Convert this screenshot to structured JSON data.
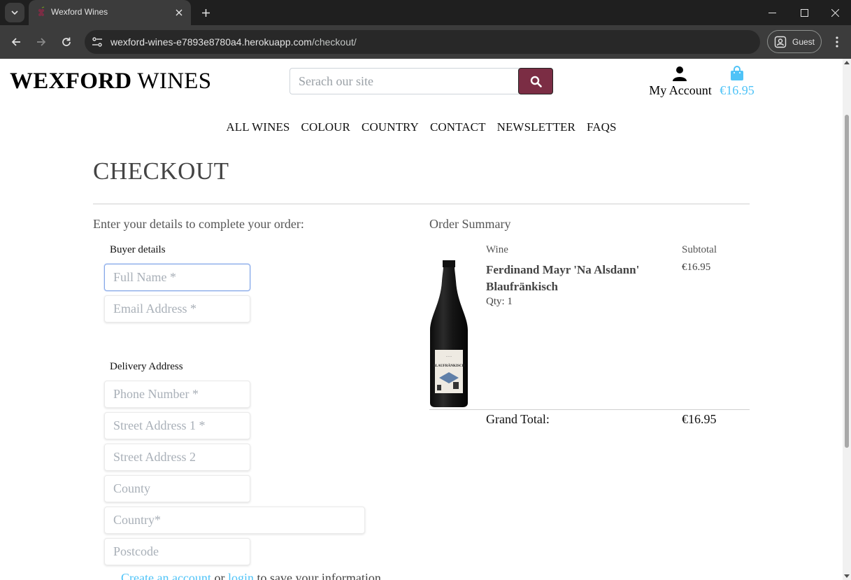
{
  "browser": {
    "tab_title": "Wexford Wines",
    "url_host": "wexford-wines-e7893e8780a4.herokuapp.com",
    "url_path": "/checkout/",
    "profile_label": "Guest"
  },
  "header": {
    "logo_bold": "WEXFORD",
    "logo_regular": " WINES",
    "search_placeholder": "Serach our site",
    "account_label": "My Account",
    "bag_total": "€16.95",
    "accent_color": "#7b2d44",
    "link_color": "#4fc3f7"
  },
  "nav": {
    "items": [
      "ALL WINES",
      "COLOUR",
      "COUNTRY",
      "CONTACT",
      "NEWSLETTER",
      "FAQS"
    ]
  },
  "checkout": {
    "title": "CHECKOUT",
    "intro": "Enter your details to complete your order:",
    "buyer_label": "Buyer details",
    "full_name_placeholder": "Full Name *",
    "email_placeholder": "Email Address *",
    "delivery_label": "Delivery Address",
    "phone_placeholder": "Phone Number *",
    "street1_placeholder": "Street Address 1 *",
    "street2_placeholder": "Street Address 2",
    "county_placeholder": "County",
    "country_placeholder": "Country*",
    "postcode_placeholder": "Postcode",
    "save_info": {
      "create_link": "Create an account",
      "or_text": " or ",
      "login_link": "login",
      "suffix": " to save your information"
    }
  },
  "summary": {
    "title": "Order Summary",
    "col_wine": "Wine",
    "col_subtotal": "Subtotal",
    "item": {
      "name": "Ferdinand Mayr 'Na Alsdann' Blaufränkisch",
      "qty": "Qty: 1",
      "subtotal": "€16.95",
      "label_text": "BLAUFRÄNKISCH"
    },
    "grand_total_label": "Grand Total:",
    "grand_total_value": "€16.95"
  }
}
